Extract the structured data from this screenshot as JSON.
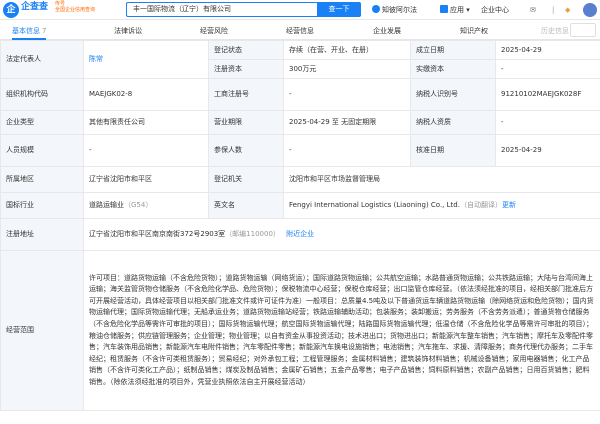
{
  "topbar": {
    "logo_char": "企",
    "brand": "企查查",
    "brand_tag_line1": "传号",
    "brand_tag_line2": "全国企业信用查询",
    "search_value": "丰一国际物流（辽宁）有限公司",
    "search_button": "查一下",
    "knowledge_label": "知彼阿尔法",
    "app_label": "应用",
    "enterprise_center": "企业中心"
  },
  "tabs": [
    {
      "label": "基本信息",
      "count": "7"
    },
    {
      "label": "法律诉讼",
      "count": ""
    },
    {
      "label": "经营风险",
      "count": ""
    },
    {
      "label": "经营信息",
      "count": ""
    },
    {
      "label": "企业发展",
      "count": ""
    },
    {
      "label": "知识产权",
      "count": ""
    },
    {
      "label": "历史信息",
      "count": ""
    }
  ],
  "info": {
    "legal_rep_label": "法定代表人",
    "legal_rep_value": "陈常",
    "reg_status_label": "登记状态",
    "reg_status_value": "存续（在营、开业、在册）",
    "founded_label": "成立日期",
    "founded_value": "2025-04-29",
    "reg_capital_label": "注册资本",
    "reg_capital_value": "300万元",
    "paid_capital_label": "实缴资本",
    "paid_capital_value": "-",
    "org_code_label": "组织机构代码",
    "org_code_value": "MAEJGK02-8",
    "biz_reg_label": "工商注册号",
    "biz_reg_value": "-",
    "taxpayer_id_label": "纳税人识别号",
    "taxpayer_id_value": "91210102MAEJGK028F",
    "type_label": "企业类型",
    "type_value": "其他有限责任公司",
    "term_label": "营业期限",
    "term_value": "2025-04-29 至 无固定期限",
    "taxpayer_qual_label": "纳税人资质",
    "taxpayer_qual_value": "-",
    "staff_label": "人员规模",
    "staff_value": "-",
    "insured_label": "参保人数",
    "insured_value": "-",
    "approved_label": "核准日期",
    "approved_value": "2025-04-29",
    "region_label": "所属地区",
    "region_value": "辽宁省沈阳市和平区",
    "authority_label": "登记机关",
    "authority_value": "沈阳市和平区市场监督管理局",
    "industry_label": "国标行业",
    "industry_value": "道路运输业",
    "industry_code": "（G54）",
    "english_label": "英文名",
    "english_value": "Fengyi International Logistics (Liaoning) Co., Ltd.",
    "english_note": "（自动翻译）",
    "english_update": "更新",
    "address_label": "注册地址",
    "address_value": "辽宁省沈阳市和平区南京南街372号2903室",
    "postcode": "（邮编110000）",
    "nearby_link": "附近企业",
    "scope_label": "经营范围",
    "scope_value": "许可项目：道路货物运输（不含危险货物）；道路货物运输（网络货运）；国际道路货物运输；公共航空运输；水路普通货物运输；公共铁路运输；大陆与台湾间海上运输；海关监管货物仓储服务（不含危险化学品、危险货物）；保税物流中心经营；保税仓库经营；出口监管仓库经营。（依法须经批准的项目，经相关部门批准后方可开展经营活动，具体经营项目以相关部门批准文件或许可证件为准）一般项目：总质量4.5吨及以下普通货运车辆道路货物运输（除网络货运和危险货物）；国内货物运输代理；国际货物运输代理；无船承运业务；道路货物运输站经营；铁路运输辅助活动；包装服务；装卸搬运；劳务服务（不含劳务派遣）；普通货物仓储服务（不含危险化学品等需许可审批的项目）；国际货物运输代理；航空国际货物运输代理；陆路国际货物运输代理；低温仓储（不含危险化学品等需许可审批的项目）；粮油仓储服务；供应链管理服务；企业管理；物业管理；以自有资金从事投资活动；技术进出口；货物进出口；新能源汽车整车销售；汽车销售；摩托车及零配件零售；汽车装饰用品销售；新能源汽车电附件销售；汽车零配件零售；新能源汽车换电设施销售；电池销售；汽车拖车、求援、清障服务；商务代理代办服务；二手车经纪；租赁服务（不含许可类租赁服务）；贸易经纪；对外承包工程；工程管理服务；金属材料销售；建筑装饰材料销售；机械设备销售；家用电器销售；化工产品销售（不含许可类化工产品）；纸制品销售；煤炭及制品销售；金属矿石销售；五金产品零售；电子产品销售；饲料原料销售；农副产品销售；日用百货销售；肥料销售。（除依法须经批准的项目外，凭营业执照依法自主开展经营活动）"
  },
  "colors": {
    "accent": "#1a80f5",
    "label_bg": "#f3f6fa",
    "border": "#e8e8e8",
    "brand_tag": "#ff6a00"
  }
}
